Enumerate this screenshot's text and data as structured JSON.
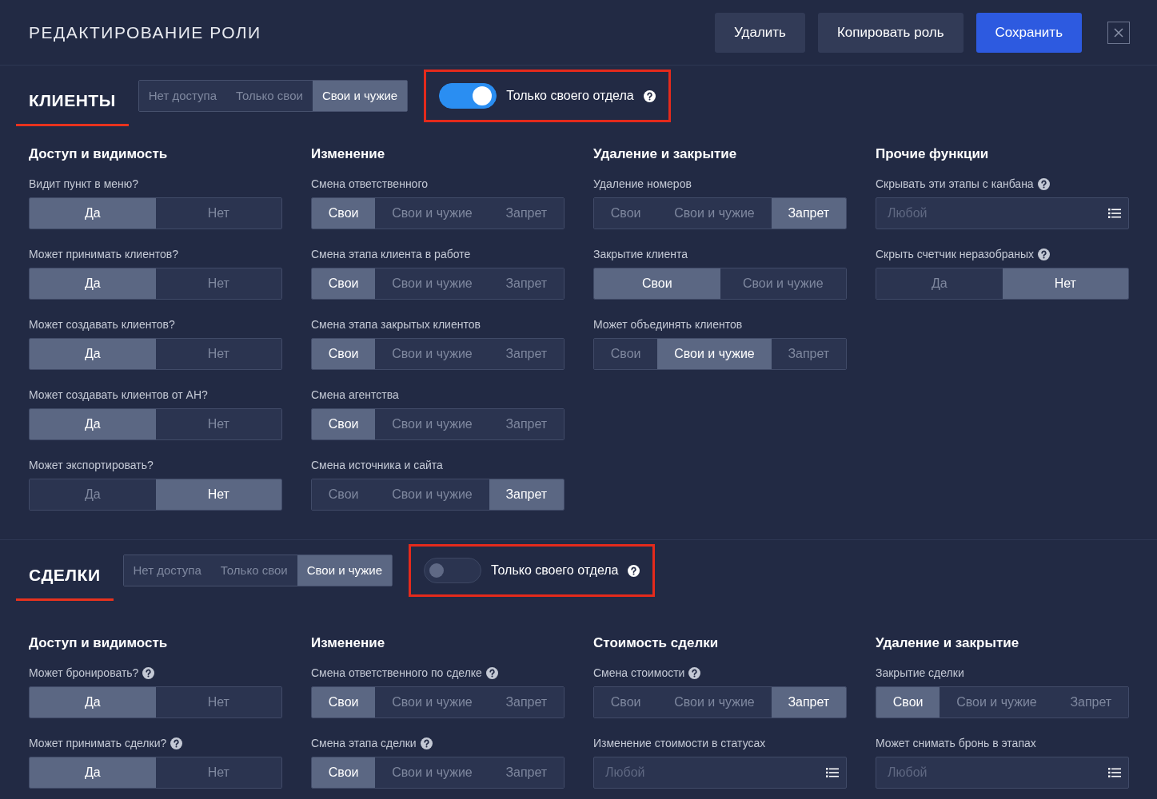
{
  "header": {
    "title": "РЕДАКТИРОВАНИЕ РОЛИ",
    "buttons": [
      {
        "label": "Удалить",
        "kind": "secondary"
      },
      {
        "label": "Копировать роль",
        "kind": "secondary"
      },
      {
        "label": "Сохранить",
        "kind": "primary"
      }
    ]
  },
  "sections": [
    {
      "title": "КЛИЕНТЫ",
      "access": [
        {
          "label": "Нет доступа",
          "selected": false
        },
        {
          "label": "Только свои",
          "selected": false
        },
        {
          "label": "Свои и чужие",
          "selected": true
        }
      ],
      "toggle": {
        "label": "Только своего отдела",
        "on": true,
        "help": true,
        "highlighted": true
      },
      "columns": [
        {
          "title": "Доступ и видимость",
          "fields": [
            {
              "label": "Видит пункт в меню?",
              "help": false,
              "kind": "segmented",
              "options": [
                {
                  "label": "Да",
                  "selected": true
                },
                {
                  "label": "Нет",
                  "selected": false
                }
              ]
            },
            {
              "label": "Может принимать клиентов?",
              "help": false,
              "kind": "segmented",
              "options": [
                {
                  "label": "Да",
                  "selected": true
                },
                {
                  "label": "Нет",
                  "selected": false
                }
              ]
            },
            {
              "label": "Может создавать клиентов?",
              "help": false,
              "kind": "segmented",
              "options": [
                {
                  "label": "Да",
                  "selected": true
                },
                {
                  "label": "Нет",
                  "selected": false
                }
              ]
            },
            {
              "label": "Может создавать клиентов от АН?",
              "help": false,
              "kind": "segmented",
              "options": [
                {
                  "label": "Да",
                  "selected": true
                },
                {
                  "label": "Нет",
                  "selected": false
                }
              ]
            },
            {
              "label": "Может экспортировать?",
              "help": false,
              "kind": "segmented",
              "options": [
                {
                  "label": "Да",
                  "selected": false
                },
                {
                  "label": "Нет",
                  "selected": true
                }
              ]
            }
          ]
        },
        {
          "title": "Изменение",
          "fields": [
            {
              "label": "Смена ответственного",
              "help": false,
              "kind": "segmented",
              "options": [
                {
                  "label": "Свои",
                  "selected": true
                },
                {
                  "label": "Свои и чужие",
                  "selected": false
                },
                {
                  "label": "Запрет",
                  "selected": false
                }
              ]
            },
            {
              "label": "Смена этапа клиента в работе",
              "help": false,
              "kind": "segmented",
              "options": [
                {
                  "label": "Свои",
                  "selected": true
                },
                {
                  "label": "Свои и чужие",
                  "selected": false
                },
                {
                  "label": "Запрет",
                  "selected": false
                }
              ]
            },
            {
              "label": "Смена этапа закрытых клиентов",
              "help": false,
              "kind": "segmented",
              "options": [
                {
                  "label": "Свои",
                  "selected": true
                },
                {
                  "label": "Свои и чужие",
                  "selected": false
                },
                {
                  "label": "Запрет",
                  "selected": false
                }
              ]
            },
            {
              "label": "Смена агентства",
              "help": false,
              "kind": "segmented",
              "options": [
                {
                  "label": "Свои",
                  "selected": true
                },
                {
                  "label": "Свои и чужие",
                  "selected": false
                },
                {
                  "label": "Запрет",
                  "selected": false
                }
              ]
            },
            {
              "label": "Смена источника и сайта",
              "help": false,
              "kind": "segmented",
              "options": [
                {
                  "label": "Свои",
                  "selected": false
                },
                {
                  "label": "Свои и чужие",
                  "selected": false
                },
                {
                  "label": "Запрет",
                  "selected": true
                }
              ]
            }
          ]
        },
        {
          "title": "Удаление и закрытие",
          "fields": [
            {
              "label": "Удаление номеров",
              "help": false,
              "kind": "segmented",
              "options": [
                {
                  "label": "Свои",
                  "selected": false
                },
                {
                  "label": "Свои и чужие",
                  "selected": false
                },
                {
                  "label": "Запрет",
                  "selected": true
                }
              ]
            },
            {
              "label": "Закрытие клиента",
              "help": false,
              "kind": "segmented",
              "options": [
                {
                  "label": "Свои",
                  "selected": true
                },
                {
                  "label": "Свои и чужие",
                  "selected": false
                }
              ]
            },
            {
              "label": "Может объединять клиентов",
              "help": false,
              "kind": "segmented",
              "options": [
                {
                  "label": "Свои",
                  "selected": false
                },
                {
                  "label": "Свои и чужие",
                  "selected": true
                },
                {
                  "label": "Запрет",
                  "selected": false
                }
              ]
            }
          ]
        },
        {
          "title": "Прочие функции",
          "fields": [
            {
              "label": "Скрывать эти этапы с канбана",
              "help": true,
              "kind": "select",
              "placeholder": "Любой"
            },
            {
              "label": "Скрыть счетчик неразобраных",
              "help": true,
              "kind": "segmented",
              "options": [
                {
                  "label": "Да",
                  "selected": false
                },
                {
                  "label": "Нет",
                  "selected": true
                }
              ]
            }
          ]
        }
      ]
    },
    {
      "title": "СДЕЛКИ",
      "access": [
        {
          "label": "Нет доступа",
          "selected": false
        },
        {
          "label": "Только свои",
          "selected": false
        },
        {
          "label": "Свои и чужие",
          "selected": true
        }
      ],
      "toggle": {
        "label": "Только своего отдела",
        "on": false,
        "help": true,
        "highlighted": true
      },
      "columns": [
        {
          "title": "Доступ и видимость",
          "fields": [
            {
              "label": "Может бронировать?",
              "help": true,
              "kind": "segmented",
              "options": [
                {
                  "label": "Да",
                  "selected": true
                },
                {
                  "label": "Нет",
                  "selected": false
                }
              ]
            },
            {
              "label": "Может принимать сделки?",
              "help": true,
              "kind": "segmented",
              "options": [
                {
                  "label": "Да",
                  "selected": true
                },
                {
                  "label": "Нет",
                  "selected": false
                }
              ]
            }
          ]
        },
        {
          "title": "Изменение",
          "fields": [
            {
              "label": "Смена ответственного по сделке",
              "help": true,
              "kind": "segmented",
              "options": [
                {
                  "label": "Свои",
                  "selected": true
                },
                {
                  "label": "Свои и чужие",
                  "selected": false
                },
                {
                  "label": "Запрет",
                  "selected": false
                }
              ]
            },
            {
              "label": "Смена этапа сделки",
              "help": true,
              "kind": "segmented",
              "options": [
                {
                  "label": "Свои",
                  "selected": true
                },
                {
                  "label": "Свои и чужие",
                  "selected": false
                },
                {
                  "label": "Запрет",
                  "selected": false
                }
              ]
            }
          ]
        },
        {
          "title": "Стоимость сделки",
          "fields": [
            {
              "label": "Смена стоимости",
              "help": true,
              "kind": "segmented",
              "options": [
                {
                  "label": "Свои",
                  "selected": false
                },
                {
                  "label": "Свои и чужие",
                  "selected": false
                },
                {
                  "label": "Запрет",
                  "selected": true
                }
              ]
            },
            {
              "label": "Изменение стоимости в статусах",
              "help": false,
              "kind": "select",
              "placeholder": "Любой"
            }
          ]
        },
        {
          "title": "Удаление и закрытие",
          "fields": [
            {
              "label": "Закрытие сделки",
              "help": false,
              "kind": "segmented",
              "options": [
                {
                  "label": "Свои",
                  "selected": true
                },
                {
                  "label": "Свои и чужие",
                  "selected": false
                },
                {
                  "label": "Запрет",
                  "selected": false
                }
              ]
            },
            {
              "label": "Может снимать бронь в этапах",
              "help": false,
              "kind": "select",
              "placeholder": "Любой"
            }
          ]
        }
      ]
    }
  ]
}
